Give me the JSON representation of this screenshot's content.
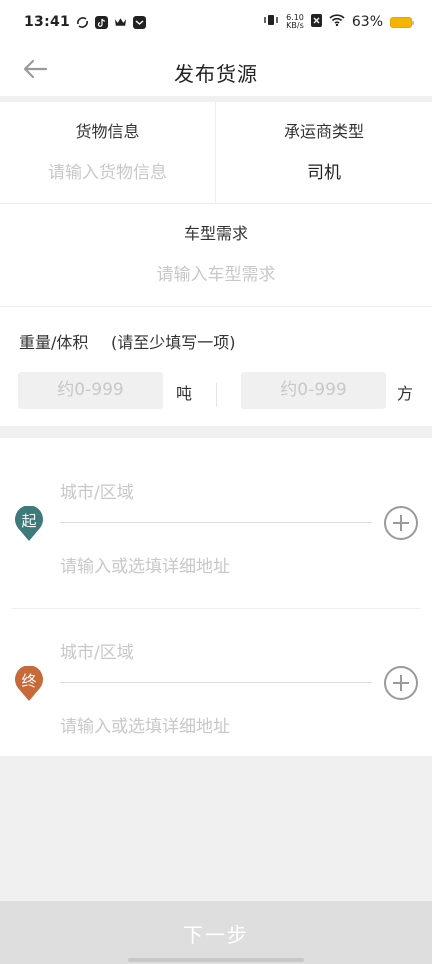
{
  "status_bar": {
    "time": "13:41",
    "net_speed_top": "6.10",
    "net_speed_bottom": "KB/s",
    "battery": "63%",
    "battery_level": 0.63,
    "icons": [
      "sync-icon",
      "tiktok-icon",
      "crown-icon",
      "message-icon",
      "vibrate-icon",
      "sim-x-icon",
      "wifi-icon",
      "battery-icon"
    ]
  },
  "nav": {
    "title": "发布货源",
    "back_icon": "arrow-left-icon"
  },
  "cargo": {
    "label": "货物信息",
    "placeholder": "请输入货物信息"
  },
  "carrier": {
    "label": "承运商类型",
    "value": "司机"
  },
  "vehicle": {
    "label": "车型需求",
    "placeholder": "请输入车型需求"
  },
  "weight_volume": {
    "label": "重量/体积",
    "hint": "(请至少填写一项)",
    "weight_placeholder": "约0-999",
    "weight_unit": "吨",
    "volume_placeholder": "约0-999",
    "volume_unit": "方"
  },
  "start": {
    "badge": "起",
    "badge_color": "#3f7a7a",
    "city_placeholder": "城市/区域",
    "detail_placeholder": "请输入或选填详细地址"
  },
  "end": {
    "badge": "终",
    "badge_color": "#c8693a",
    "city_placeholder": "城市/区域",
    "detail_placeholder": "请输入或选填详细地址"
  },
  "footer": {
    "next_label": "下一步"
  }
}
